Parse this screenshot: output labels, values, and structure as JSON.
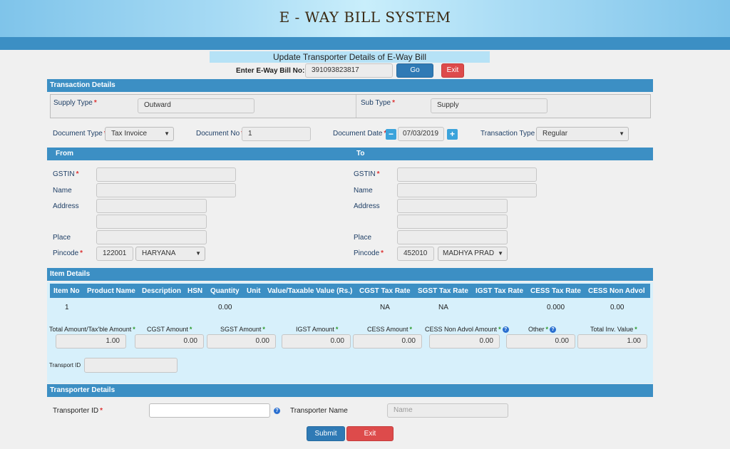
{
  "header": {
    "title": "E - WAY BILL SYSTEM"
  },
  "update": {
    "title": "Update Transporter Details of E-Way Bill",
    "ewb_label": "Enter E-Way Bill No:",
    "ewb_value": "391093823817",
    "go_label": "Go",
    "exit_label": "Exit"
  },
  "transaction": {
    "section_title": "Transaction Details",
    "supply_type_label": "Supply Type",
    "supply_type_value": "Outward",
    "sub_type_label": "Sub Type",
    "sub_type_value": "Supply",
    "doc_type_label": "Document Type",
    "doc_type_value": "Tax Invoice",
    "doc_no_label": "Document No",
    "doc_no_value": "1",
    "doc_date_label": "Document Date",
    "doc_date_value": "07/03/2019",
    "txn_type_label": "Transaction Type",
    "txn_type_value": "Regular"
  },
  "from": {
    "title": "From",
    "gstin_label": "GSTIN",
    "name_label": "Name",
    "address_label": "Address",
    "place_label": "Place",
    "pincode_label": "Pincode",
    "pincode_value": "122001",
    "state_value": "HARYANA"
  },
  "to": {
    "title": "To",
    "gstin_label": "GSTIN",
    "name_label": "Name",
    "address_label": "Address",
    "place_label": "Place",
    "pincode_label": "Pincode",
    "pincode_value": "452010",
    "state_value": "MADHYA PRAD"
  },
  "items": {
    "section_title": "Item Details",
    "columns": [
      "Item No",
      "Product Name",
      "Description",
      "HSN",
      "Quantity",
      "Unit",
      "Value/Taxable Value (Rs.)",
      "CGST Tax Rate",
      "SGST Tax Rate",
      "IGST Tax Rate",
      "CESS Tax Rate",
      "CESS Non Advol"
    ],
    "row": {
      "item_no": "1",
      "quantity": "0.00",
      "cgst": "NA",
      "sgst": "NA",
      "cess_rate": "0.000",
      "cess_non_advol": "0.00"
    },
    "totals": {
      "total_label": "Total Amount/Tax'ble Amount",
      "total_value": "1.00",
      "cgst_label": "CGST Amount",
      "cgst_value": "0.00",
      "sgst_label": "SGST Amount",
      "sgst_value": "0.00",
      "igst_label": "IGST Amount",
      "igst_value": "0.00",
      "cess_label": "CESS Amount",
      "cess_value": "0.00",
      "cess_non_label": "CESS Non Advol Amount",
      "cess_non_value": "0.00",
      "other_label": "Other",
      "other_value": "0.00",
      "total_inv_label": "Total Inv. Value",
      "total_inv_value": "1.00"
    },
    "transport_id_label": "Transport ID"
  },
  "transporter": {
    "section_title": "Transporter Details",
    "id_label": "Transporter ID",
    "name_label": "Transporter Name",
    "name_placeholder": "Name",
    "submit_label": "Submit",
    "exit_label": "Exit"
  },
  "colors": {
    "bar": "#3c8fc4",
    "go": "#2f7ab5",
    "exit": "#dd4b4b",
    "required": "#d33",
    "required_green": "#2a9a2a",
    "info": "#2a6fd0"
  }
}
